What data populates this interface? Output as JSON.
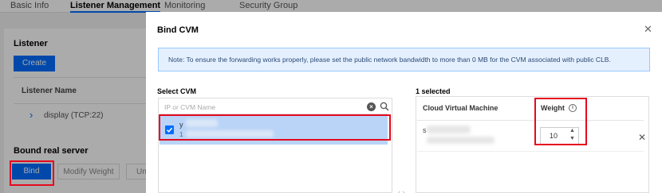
{
  "tabs": [
    "Basic Info",
    "Listener Management",
    "Monitoring",
    "Security Group"
  ],
  "listener": {
    "title": "Listener",
    "create_label": "Create",
    "column_header": "Listener Name",
    "row_label": "display (TCP:22)"
  },
  "bound": {
    "title": "Bound real server",
    "bind_label": "Bind",
    "modify_weight_label": "Modify Weight",
    "unbind_label": "Un"
  },
  "modal": {
    "title": "Bind CVM",
    "note": "Note: To ensure the forwarding works properly, please set the public network bandwidth to more than 0 MB for the CVM associated with public CLB.",
    "left": {
      "label": "Select CVM",
      "search_placeholder": "IP or CVM Name",
      "item": {
        "name": "y",
        "sub": "1",
        "checked": true
      }
    },
    "right": {
      "label": "1 selected",
      "col_machine": "Cloud Virtual Machine",
      "col_weight": "Weight",
      "row": {
        "name": "s",
        "weight": "10"
      }
    }
  },
  "colors": {
    "accent": "#006eff",
    "highlight": "#e5091e",
    "selected_row": "#b9d4f7",
    "note_bg": "#e5f0ff"
  },
  "icons": [
    "close-icon",
    "clear-icon",
    "search-icon",
    "check-icon",
    "info-icon",
    "chevron-right-icon",
    "remove-icon"
  ]
}
